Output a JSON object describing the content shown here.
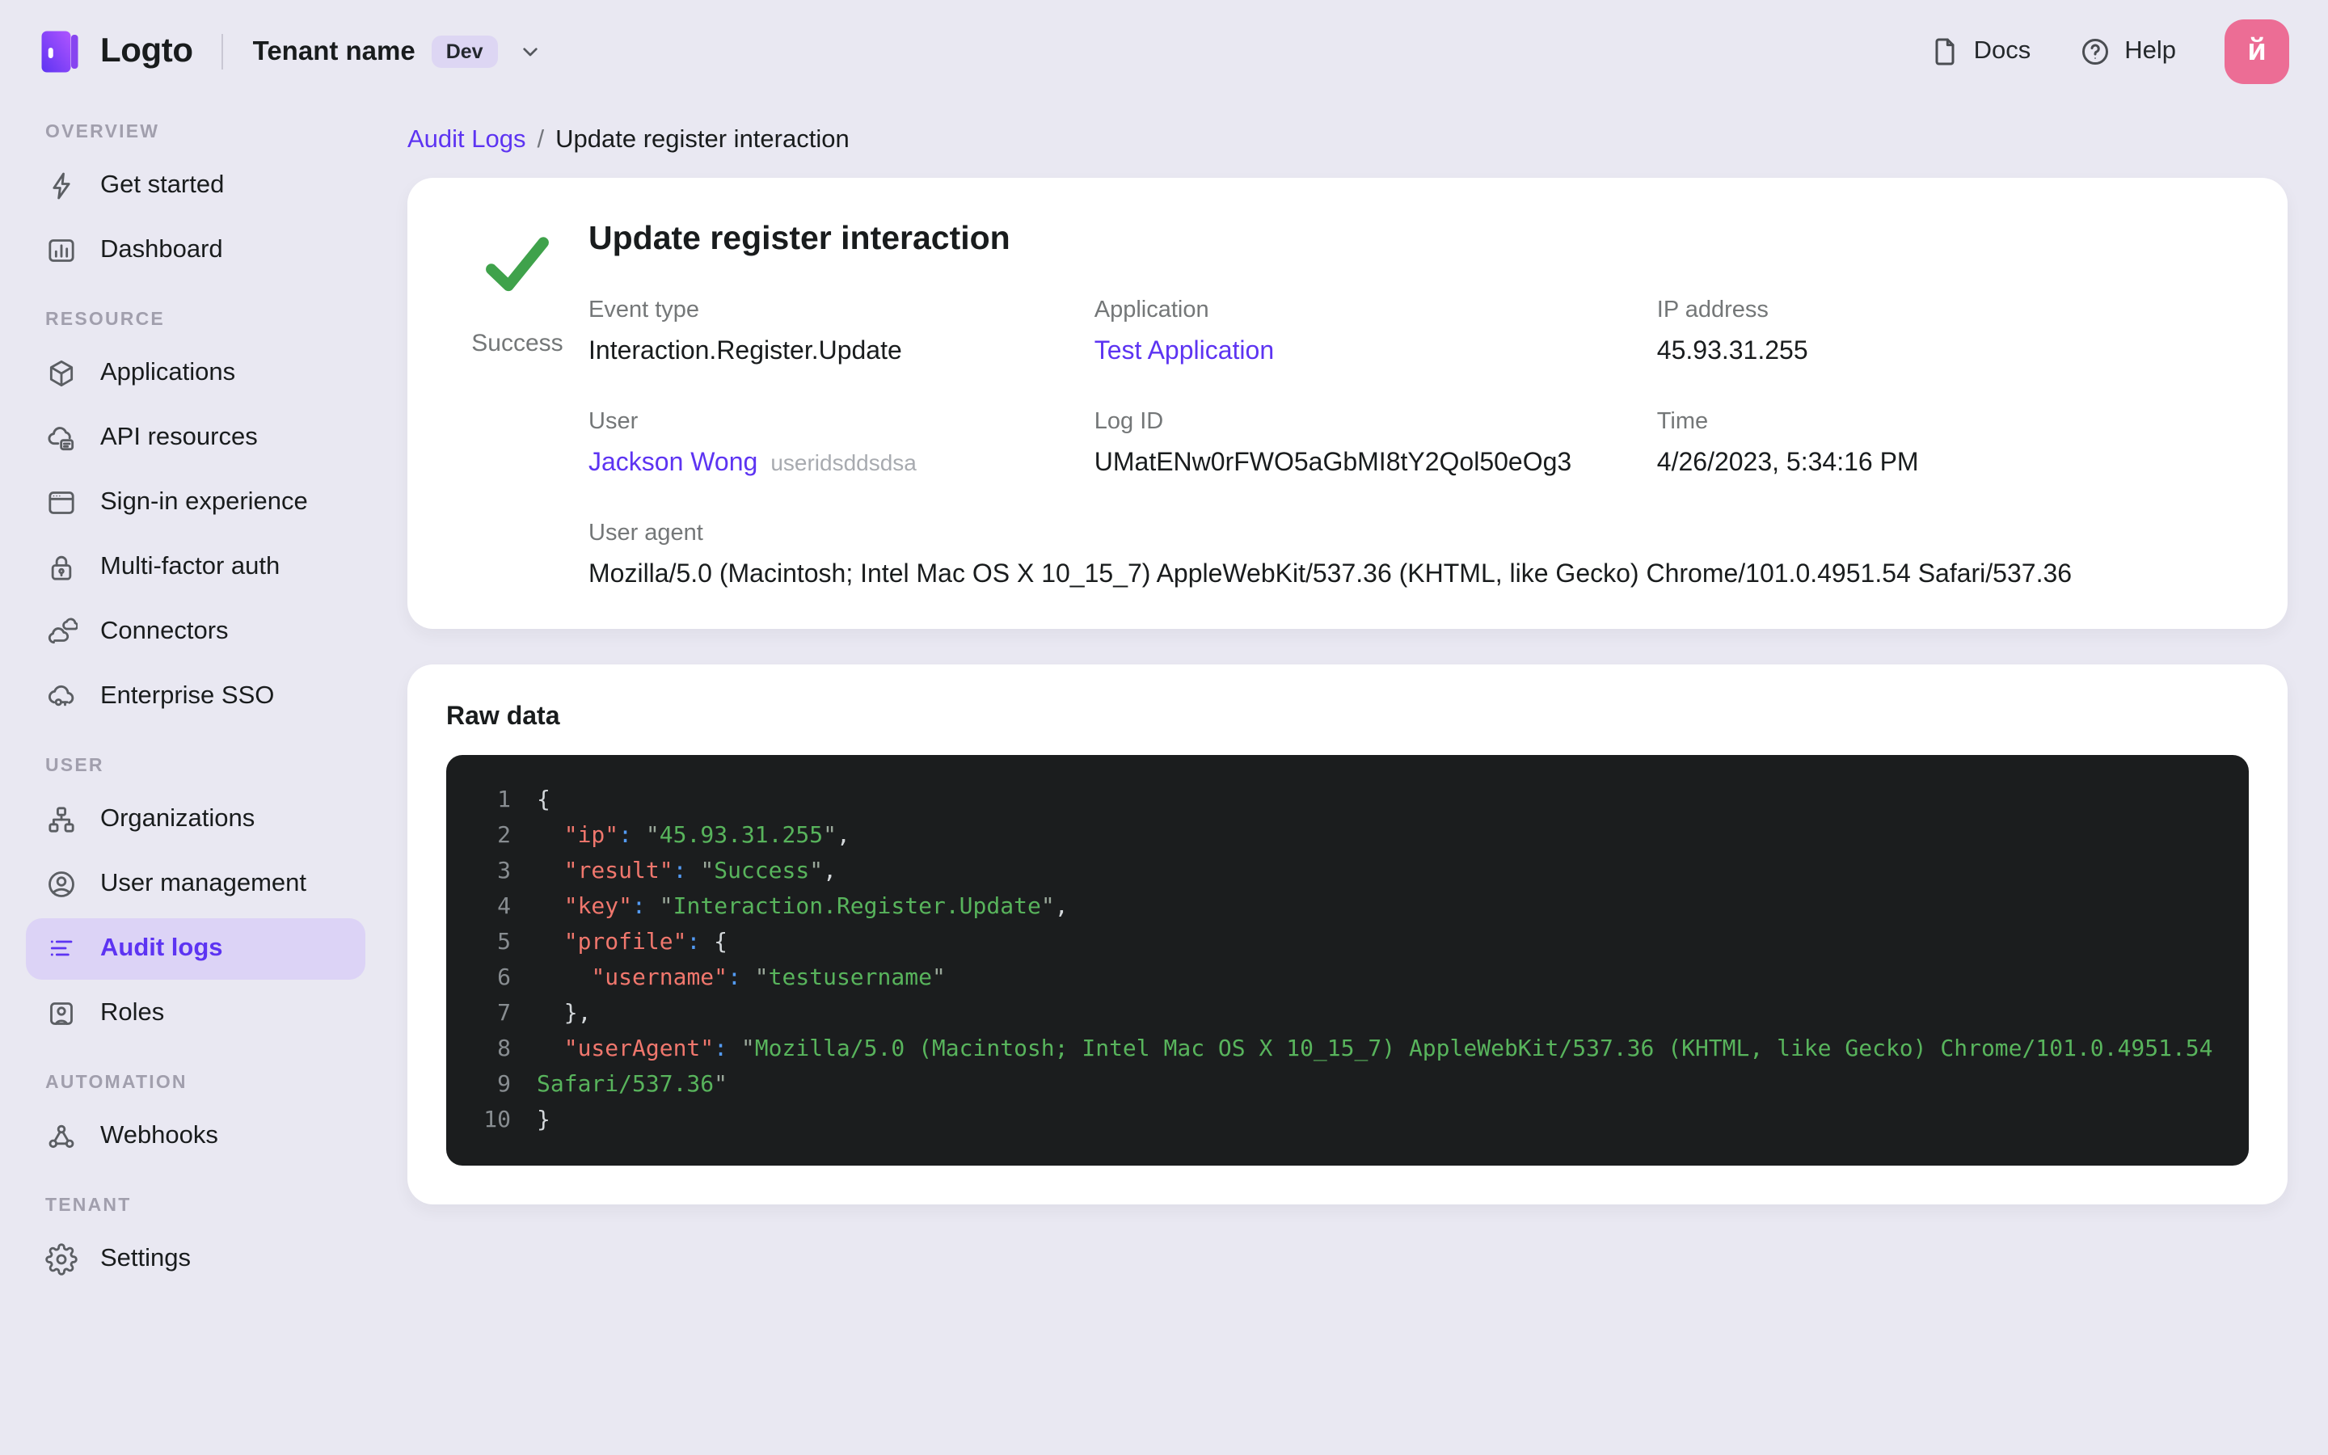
{
  "topbar": {
    "brand": "Logto",
    "tenant_name": "Tenant name",
    "tenant_badge": "Dev",
    "docs_label": "Docs",
    "help_label": "Help",
    "avatar_initial": "й"
  },
  "sidebar": {
    "sections": [
      {
        "label": "OVERVIEW",
        "items": [
          {
            "label": "Get started",
            "icon": "bolt-icon"
          },
          {
            "label": "Dashboard",
            "icon": "dashboard-icon"
          }
        ]
      },
      {
        "label": "RESOURCE",
        "items": [
          {
            "label": "Applications",
            "icon": "cube-icon"
          },
          {
            "label": "API resources",
            "icon": "api-resources-icon"
          },
          {
            "label": "Sign-in experience",
            "icon": "browser-window-icon"
          },
          {
            "label": "Multi-factor auth",
            "icon": "lock-icon"
          },
          {
            "label": "Connectors",
            "icon": "clouds-icon"
          },
          {
            "label": "Enterprise SSO",
            "icon": "cloud-key-icon"
          }
        ]
      },
      {
        "label": "USER",
        "items": [
          {
            "label": "Organizations",
            "icon": "org-tree-icon"
          },
          {
            "label": "User management",
            "icon": "user-circle-icon"
          },
          {
            "label": "Audit logs",
            "icon": "audit-list-icon",
            "active": true
          },
          {
            "label": "Roles",
            "icon": "role-card-icon"
          }
        ]
      },
      {
        "label": "AUTOMATION",
        "items": [
          {
            "label": "Webhooks",
            "icon": "webhook-icon"
          }
        ]
      },
      {
        "label": "TENANT",
        "items": [
          {
            "label": "Settings",
            "icon": "gear-icon"
          }
        ]
      }
    ]
  },
  "breadcrumb": {
    "parent": "Audit Logs",
    "separator": "/",
    "current": "Update register interaction"
  },
  "detail": {
    "title": "Update register interaction",
    "status": "Success",
    "fields": [
      {
        "label": "Event type",
        "value": "Interaction.Register.Update"
      },
      {
        "label": "Application",
        "value": "Test Application",
        "link": true
      },
      {
        "label": "IP address",
        "value": "45.93.31.255"
      },
      {
        "label": "User",
        "value": "Jackson Wong",
        "link": true,
        "suffix": "useridsddsdsa"
      },
      {
        "label": "Log ID",
        "value": "UMatENw0rFWO5aGbMI8tY2Qol50eOg3"
      },
      {
        "label": "Time",
        "value": "4/26/2023, 5:34:16 PM"
      }
    ],
    "user_agent_label": "User agent",
    "user_agent": "Mozilla/5.0 (Macintosh; Intel Mac OS X 10_15_7) AppleWebKit/537.36 (KHTML, like Gecko) Chrome/101.0.4951.54 Safari/537.36"
  },
  "raw_data": {
    "title": "Raw data",
    "lines": [
      {
        "n": "1",
        "t": [
          [
            "p",
            "{"
          ]
        ]
      },
      {
        "n": "2",
        "t": [
          [
            "p",
            "  "
          ],
          [
            "k",
            "\"ip\""
          ],
          [
            "c",
            ":"
          ],
          [
            "p",
            " "
          ],
          [
            "q",
            "\""
          ],
          [
            "s",
            "45.93.31.255"
          ],
          [
            "q",
            "\""
          ],
          [
            "p",
            ","
          ]
        ]
      },
      {
        "n": "3",
        "t": [
          [
            "p",
            "  "
          ],
          [
            "k",
            "\"result\""
          ],
          [
            "c",
            ":"
          ],
          [
            "p",
            " "
          ],
          [
            "q",
            "\""
          ],
          [
            "s",
            "Success"
          ],
          [
            "q",
            "\""
          ],
          [
            "p",
            ","
          ]
        ]
      },
      {
        "n": "4",
        "t": [
          [
            "p",
            "  "
          ],
          [
            "k",
            "\"key\""
          ],
          [
            "c",
            ":"
          ],
          [
            "p",
            " "
          ],
          [
            "q",
            "\""
          ],
          [
            "s",
            "Interaction.Register.Update"
          ],
          [
            "q",
            "\""
          ],
          [
            "p",
            ","
          ]
        ]
      },
      {
        "n": "5",
        "t": [
          [
            "p",
            "  "
          ],
          [
            "k",
            "\"profile\""
          ],
          [
            "c",
            ":"
          ],
          [
            "p",
            " {"
          ]
        ]
      },
      {
        "n": "6",
        "t": [
          [
            "p",
            "    "
          ],
          [
            "k",
            "\"username\""
          ],
          [
            "c",
            ":"
          ],
          [
            "p",
            " "
          ],
          [
            "q",
            "\""
          ],
          [
            "s",
            "testusername"
          ],
          [
            "q",
            "\""
          ]
        ]
      },
      {
        "n": "7",
        "t": [
          [
            "p",
            "  },"
          ]
        ]
      },
      {
        "n": "8",
        "t": [
          [
            "p",
            "  "
          ],
          [
            "k",
            "\"userAgent\""
          ],
          [
            "c",
            ":"
          ],
          [
            "p",
            " "
          ],
          [
            "q",
            "\""
          ],
          [
            "s",
            "Mozilla/5.0 (Macintosh; Intel Mac OS X 10_15_7) AppleWebKit/537.36 (KHTML, like Gecko) Chrome/101.0.4951.54"
          ]
        ]
      },
      {
        "n": "9",
        "t": [
          [
            "s",
            "Safari/537.36"
          ],
          [
            "q",
            "\""
          ]
        ]
      },
      {
        "n": "10",
        "t": [
          [
            "p",
            "}"
          ]
        ]
      }
    ]
  },
  "colors": {
    "accent_purple": "#5d34f2",
    "active_nav_bg": "#dcd3f6",
    "page_bg": "#e9e8f2",
    "success_green": "#3fa24b",
    "avatar_pink": "#ec6d95",
    "code_bg": "#1b1d1e",
    "code_key": "#f0776d",
    "code_colon": "#539bf5",
    "code_string": "#58b45c"
  }
}
